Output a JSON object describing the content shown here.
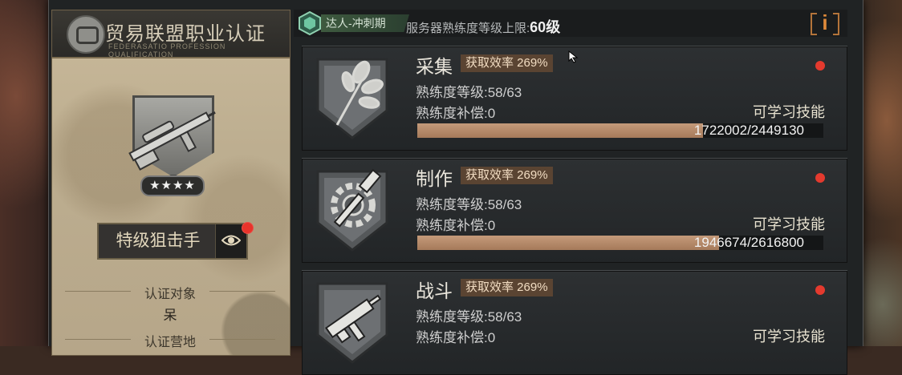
{
  "certification": {
    "title": "贸易联盟职业认证",
    "subtitle": "FEDERASATIO PROFESSION QUALIFICATION",
    "stars_text": "★★★★",
    "rank_title": "特级狙击手",
    "object_label": "认证对象",
    "object_value": "呆",
    "camp_label": "认证营地"
  },
  "header": {
    "tier_label": "达人-冲刺期",
    "server_label": "服务器熟练度等级上限:",
    "server_level": "60级",
    "info_label": "i"
  },
  "skills": [
    {
      "name": "采集",
      "rate": "获取效率 269%",
      "level": "熟练度等级:58/63",
      "compensation": "熟练度补偿:0",
      "learnable": "可学习技能",
      "progress_text": "1722002/2449130",
      "progress": 0.703,
      "icon": "plant-bundle-icon"
    },
    {
      "name": "制作",
      "rate": "获取效率 269%",
      "level": "熟练度等级:58/63",
      "compensation": "熟练度补偿:0",
      "learnable": "可学习技能",
      "progress_text": "1946674/2616800",
      "progress": 0.744,
      "icon": "gear-hammer-icon"
    },
    {
      "name": "战斗",
      "rate": "获取效率 269%",
      "level": "熟练度等级:58/63",
      "compensation": "熟练度补偿:0",
      "learnable": "可学习技能",
      "icon": "submachine-gun-icon"
    }
  ],
  "colors": {
    "accent_orange": "#e08a3a",
    "notify_red": "#e43a2e",
    "progress_fill": "#b98a68"
  }
}
